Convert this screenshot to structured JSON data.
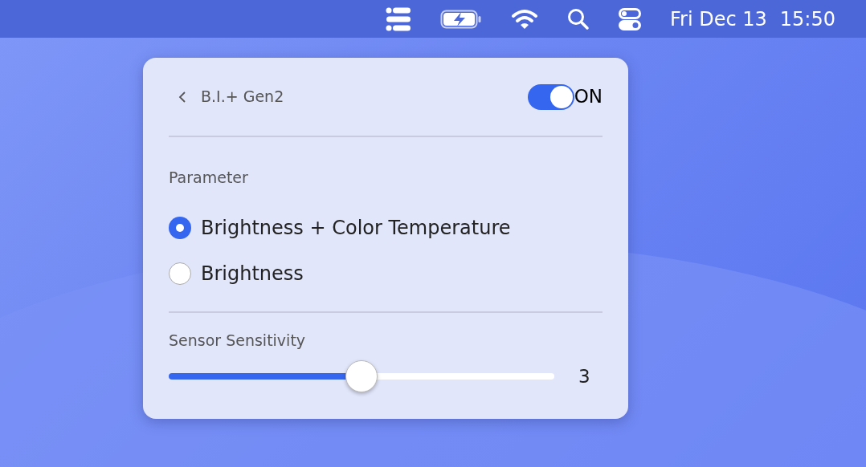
{
  "menu_bar": {
    "date": "Fri Dec 13",
    "time": "15:50"
  },
  "panel": {
    "title": "B.I.+ Gen2",
    "power": {
      "on": true,
      "label": "ON"
    },
    "parameter": {
      "label": "Parameter",
      "options": [
        {
          "label": "Brightness + Color Temperature",
          "selected": true
        },
        {
          "label": "Brightness",
          "selected": false
        }
      ]
    },
    "sensitivity": {
      "label": "Sensor Sensitivity",
      "level": 0.5,
      "reading": "3"
    }
  }
}
